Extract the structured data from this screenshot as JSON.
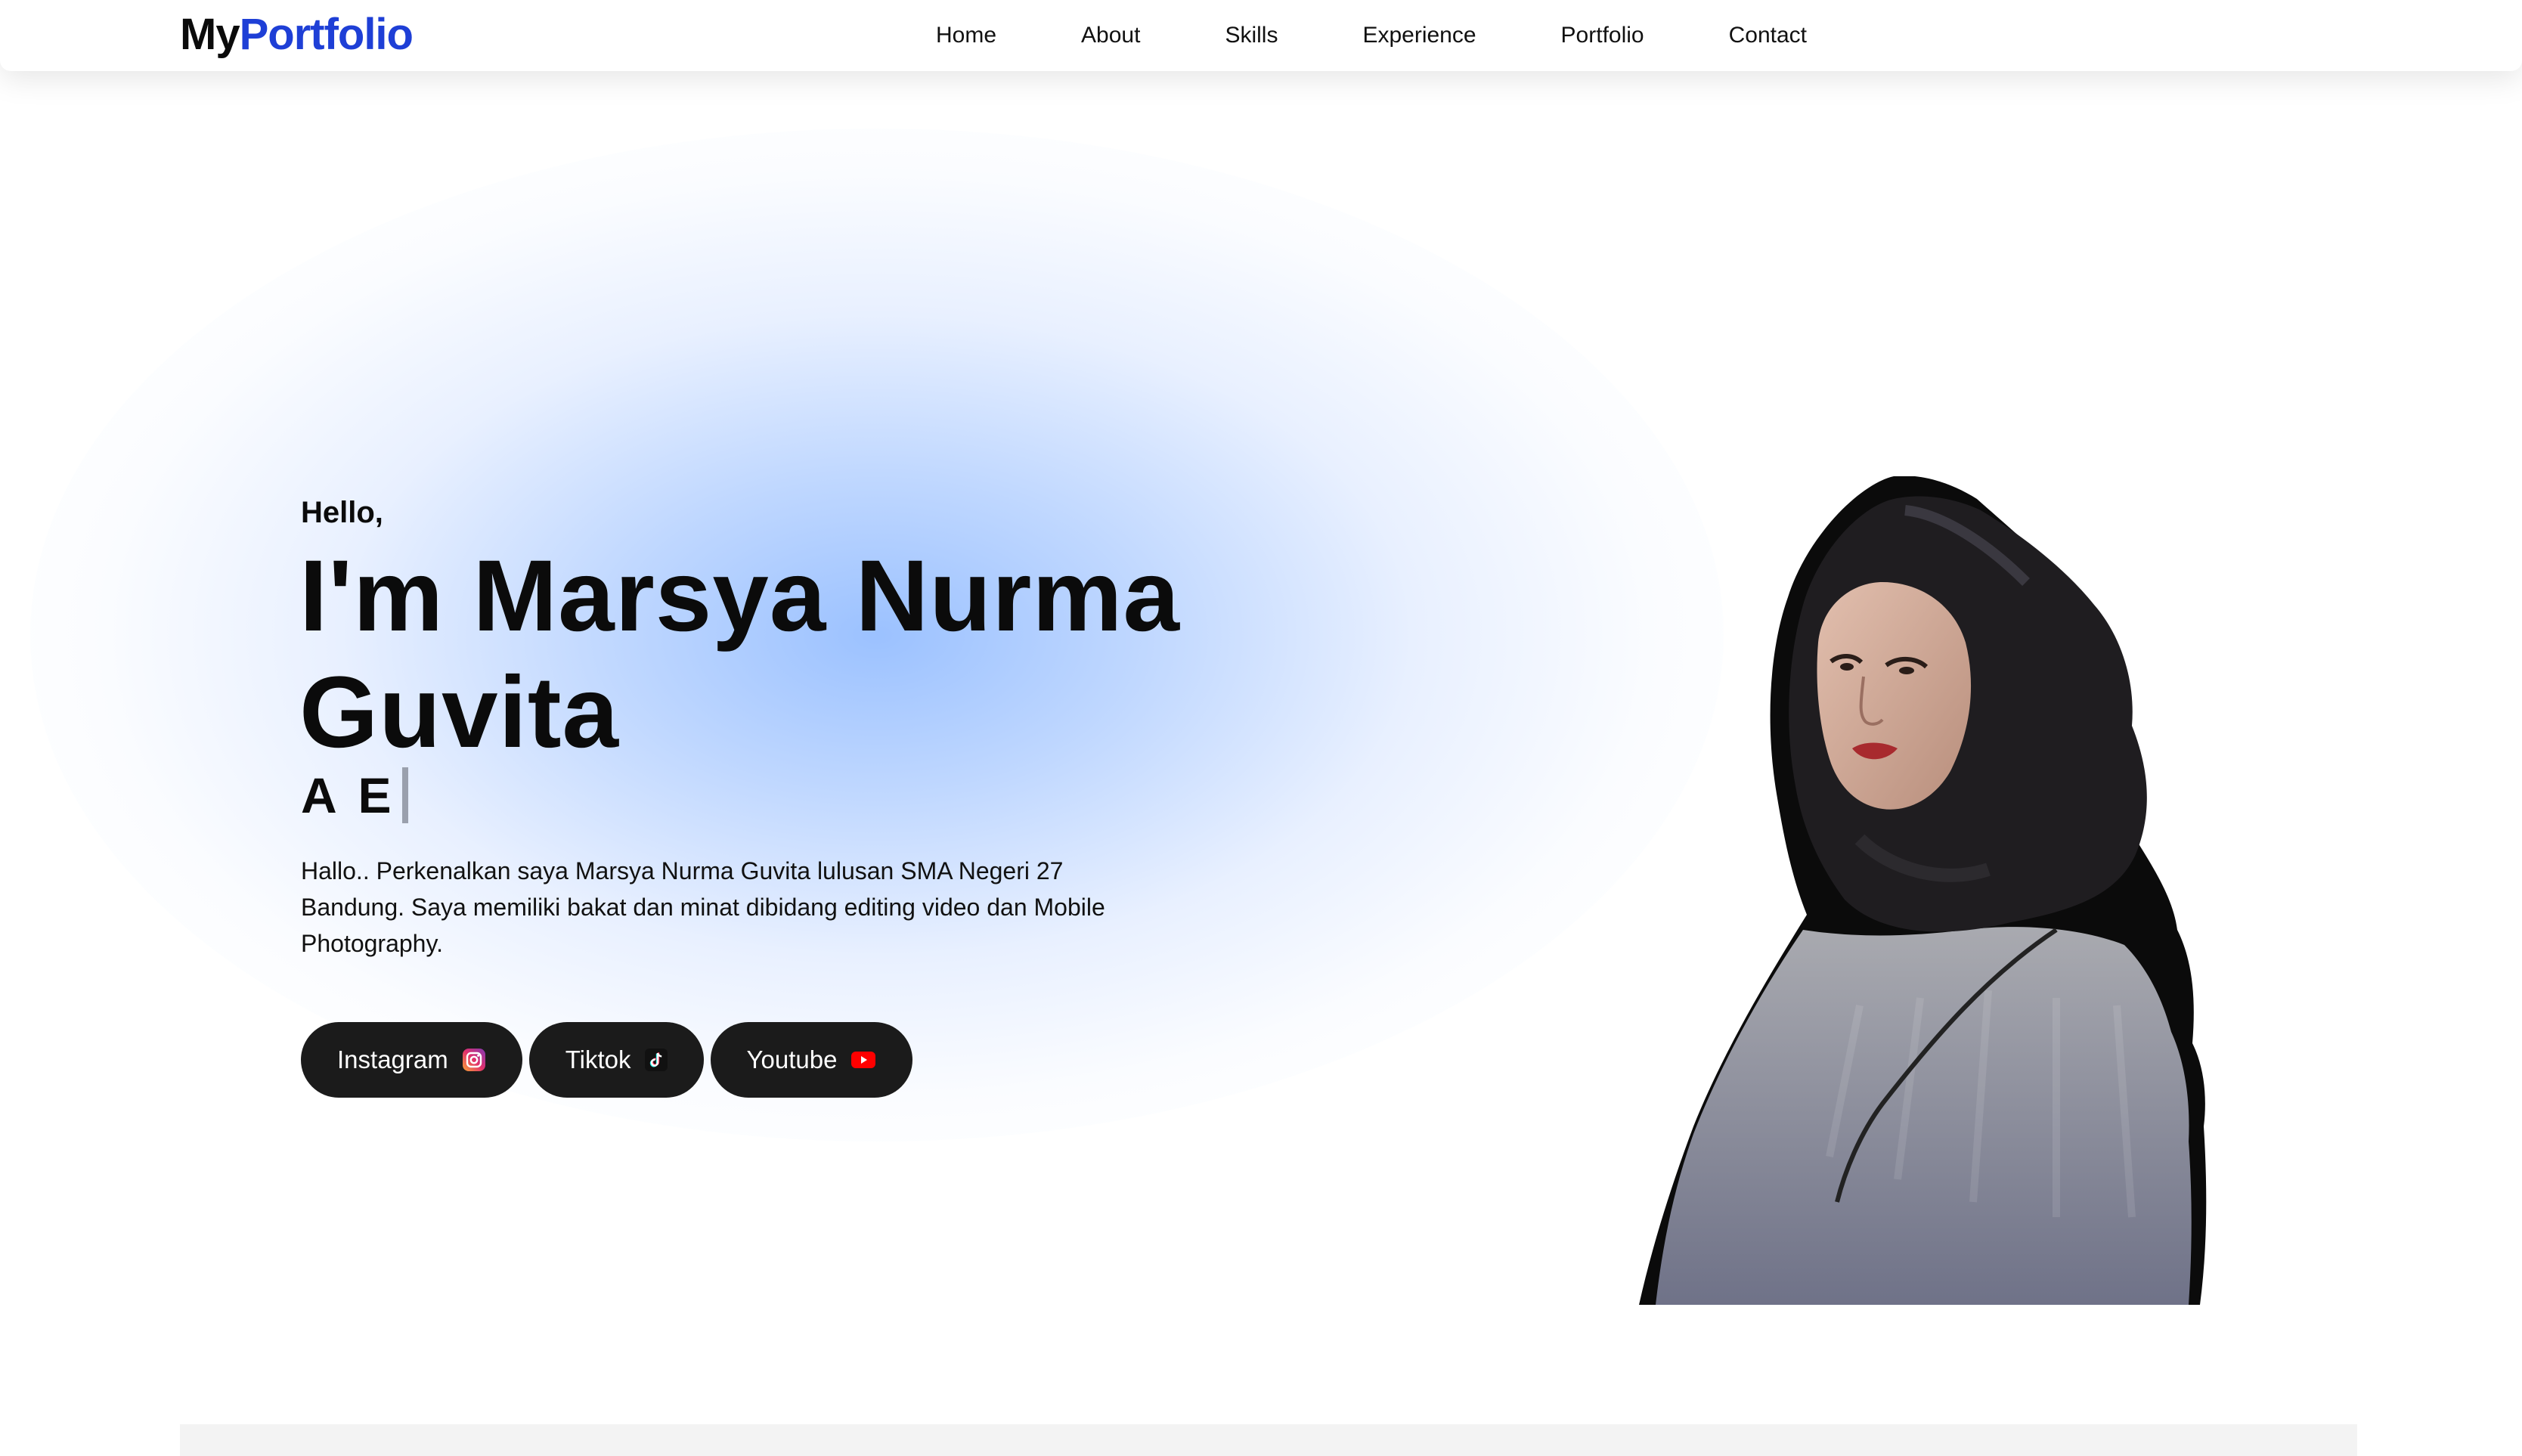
{
  "navbar": {
    "logo_prefix": "My",
    "logo_suffix": "Portfolio",
    "links": [
      "Home",
      "About",
      "Skills",
      "Experience",
      "Portfolio",
      "Contact"
    ]
  },
  "hero": {
    "greeting": "Hello,",
    "headline_line1": "I'm Marsya Nurma",
    "headline_line2": "Guvita",
    "typed_text": "A E",
    "description": "Hallo.. Perkenalkan saya Marsya Nurma Guvita lulusan SMA Negeri 27 Bandung. Saya memiliki bakat dan minat dibidang editing video dan Mobile Photography.",
    "socials": [
      {
        "label": "Instagram",
        "icon": "instagram-icon"
      },
      {
        "label": "Tiktok",
        "icon": "tiktok-icon"
      },
      {
        "label": "Youtube",
        "icon": "youtube-icon"
      }
    ]
  },
  "colors": {
    "brand_blue": "#1e3fd6",
    "button_bg": "#1b1b1b",
    "glow": "#a6c4ff"
  }
}
